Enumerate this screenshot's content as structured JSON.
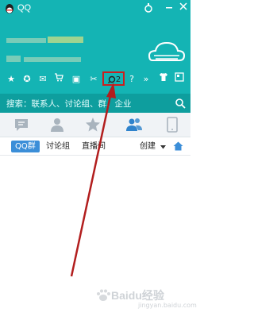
{
  "window": {
    "title": "QQ"
  },
  "toolbar": {
    "badge_count": "2"
  },
  "search": {
    "placeholder": "搜索：联系人、讨论组、群、企业"
  },
  "subtabs": {
    "qq_group": "QQ群",
    "discussion": "讨论组",
    "live": "直播间",
    "create": "创建"
  },
  "watermark": {
    "text": "Baidu经验",
    "sub": "jingyan.baidu.com"
  },
  "colors": {
    "header": "#14b4b4",
    "search_bar": "#0e9e9e",
    "highlight": "#cc1e1e"
  }
}
